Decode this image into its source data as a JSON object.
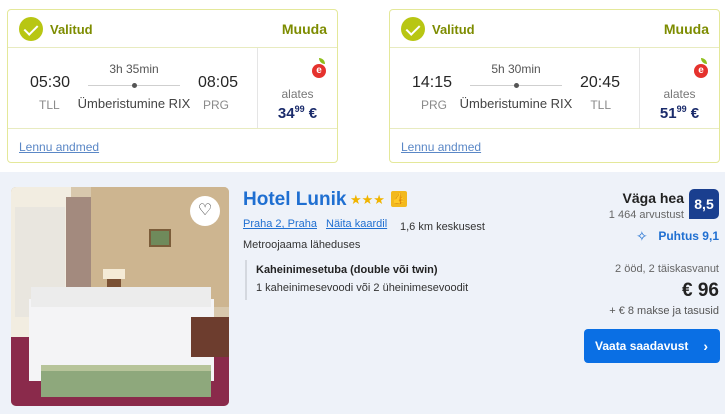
{
  "flights": [
    {
      "status": "Valitud",
      "change_label": "Muuda",
      "depart_time": "05:30",
      "arrive_time": "08:05",
      "duration": "3h 35min",
      "depart_code": "TLL",
      "arrive_code": "PRG",
      "stopover": "Ümberistumine RIX",
      "price_prefix": "alates",
      "price_main": "34",
      "price_cents": "99",
      "currency": "€",
      "details_link": "Lennu andmed"
    },
    {
      "status": "Valitud",
      "change_label": "Muuda",
      "depart_time": "14:15",
      "arrive_time": "20:45",
      "duration": "5h 30min",
      "depart_code": "PRG",
      "arrive_code": "TLL",
      "stopover": "Ümberistumine RIX",
      "price_prefix": "alates",
      "price_main": "51",
      "price_cents": "99",
      "currency": "€",
      "details_link": "Lennu andmed"
    }
  ],
  "hotel": {
    "name": "Hotel Lunik",
    "stars": "★★★",
    "location": "Praha 2, Praha",
    "map_link": "Näita kaardil",
    "distance": "1,6 km keskusest",
    "feature": "Metroojaama läheduses",
    "room_title": "Kaheinimesetuba (double või twin)",
    "room_desc": "1 kaheinimesevoodi või 2 üheinimesevoodit",
    "rating_word": "Väga hea",
    "reviews": "1 464 arvustust",
    "score": "8,5",
    "cleanliness": "Puhtus 9,1",
    "guests": "2 ööd, 2 täiskasvanut",
    "price": "€ 96",
    "tax": "+ € 8 makse ja tasusid",
    "cta": "Vaata saadavust",
    "colors": {
      "accent": "#0a6fe4",
      "selected": "#b8c613",
      "score_bg": "#1a3f8f"
    }
  }
}
